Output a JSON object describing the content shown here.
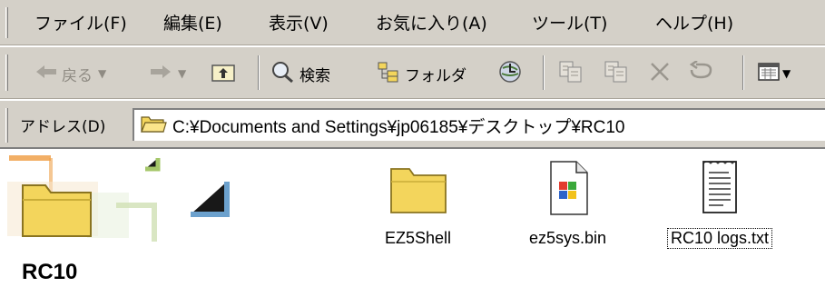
{
  "menubar": {
    "items": [
      {
        "label": "ファイル(F)"
      },
      {
        "label": "編集(E)"
      },
      {
        "label": "表示(V)"
      },
      {
        "label": "お気に入り(A)"
      },
      {
        "label": "ツール(T)"
      },
      {
        "label": "ヘルプ(H)"
      }
    ]
  },
  "toolbar": {
    "back_label": "戻る",
    "search_label": "検索",
    "folders_label": "フォルダ",
    "icons": {
      "back": "back-arrow-icon",
      "forward": "forward-arrow-icon",
      "up": "folder-up-icon",
      "search": "magnifier-icon",
      "folders": "folders-tree-icon",
      "history": "history-globe-icon",
      "move_to": "move-to-icon",
      "copy_to": "copy-to-icon",
      "delete": "delete-x-icon",
      "undo": "undo-icon",
      "views": "views-icon"
    }
  },
  "addressbar": {
    "label": "アドレス(D)",
    "path": "C:¥Documents and Settings¥jp06185¥デスクトップ¥RC10"
  },
  "content": {
    "folder_title": "RC10",
    "files": [
      {
        "name": "EZ5Shell",
        "type": "folder",
        "selected": false
      },
      {
        "name": "ez5sys.bin",
        "type": "bin",
        "selected": false
      },
      {
        "name": "RC10 logs.txt",
        "type": "txt",
        "selected": true
      }
    ]
  },
  "colors": {
    "chrome": "#d4d0c8",
    "folder_yellow": "#f3d55c",
    "decor_orange": "#f0a24c",
    "decor_blue": "#5d97c8",
    "decor_green": "#9cc25a"
  }
}
